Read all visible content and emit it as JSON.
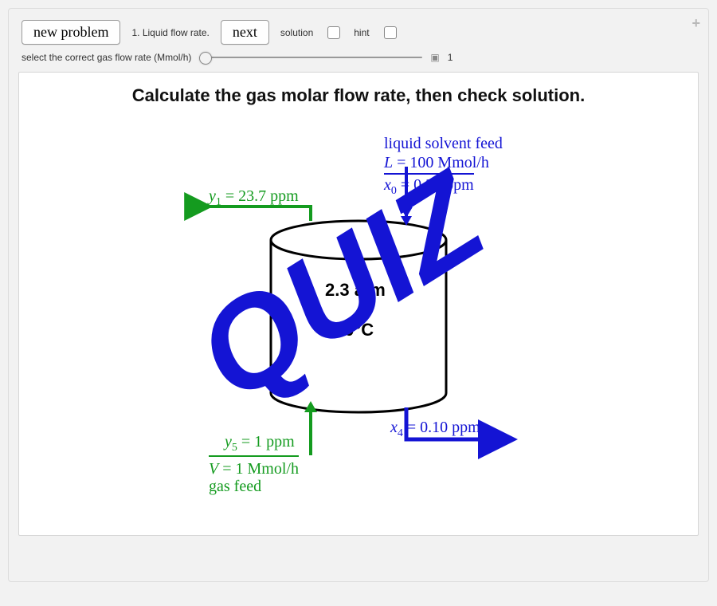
{
  "controls": {
    "new_problem": "new problem",
    "step_label": "1. Liquid flow rate.",
    "next": "next",
    "solution_label": "solution",
    "hint_label": "hint",
    "slider_label": "select the correct gas flow rate (Mmol/h)",
    "slider_value_display": "1"
  },
  "prompt": "Calculate the gas molar flow rate, then check solution.",
  "diagram": {
    "liquid_feed_title": "liquid solvent feed",
    "liquid_feed_rate_var": "L",
    "liquid_feed_rate": " = 100 Mmol/h",
    "x0_var": "x",
    "x0_sub": "0",
    "x0_val": " = 0.35 ppm",
    "y1_var": "y",
    "y1_sub": "1",
    "y1_val": " = 23.7 ppm",
    "pressure": "2.3 atm",
    "temperature": "10°C",
    "y5_var": "y",
    "y5_sub": "5",
    "y5_val": " = 1 ppm",
    "gas_feed_rate_var": "V",
    "gas_feed_rate": " = 1 Mmol/h",
    "gas_feed_label": "gas feed",
    "x4_var": "x",
    "x4_sub": "4",
    "x4_val": " = 0.10 ppm",
    "overlay_text": "QUIZ"
  }
}
